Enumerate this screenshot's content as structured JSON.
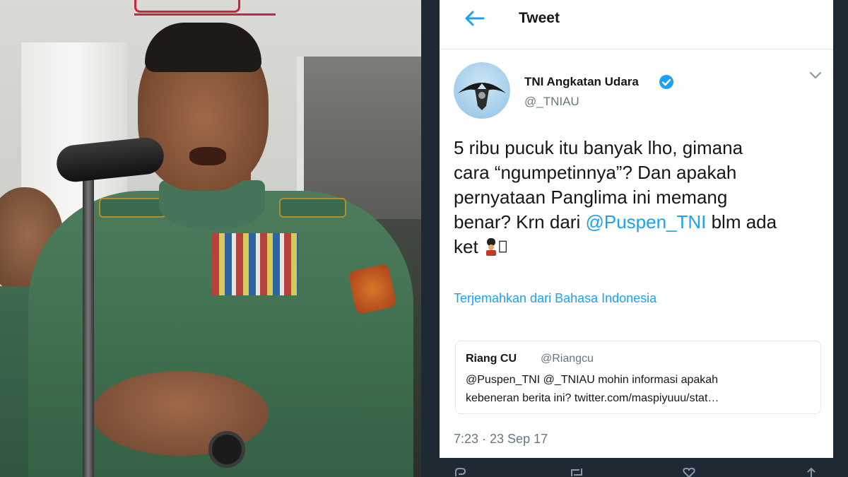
{
  "tweet_screen": {
    "title": "Tweet",
    "icons": {
      "back": "arrow-left-icon",
      "verified": "verified-badge-icon",
      "more": "chevron-down-icon",
      "emoji": "guard-emoji-icon"
    },
    "colors": {
      "accent": "#1da1f2",
      "text": "#14171a",
      "muted": "#657786"
    },
    "author": {
      "name": "TNI Angkatan Udara",
      "handle": "@_TNIAU"
    },
    "tweet": {
      "line1": "5 ribu pucuk itu banyak lho, gimana",
      "line2": "cara “ngumpetinnya”? Dan apakah",
      "line3": "pernyataan Panglima ini memang",
      "line4_before": "benar? Krn dari ",
      "line4_mention": "@Puspen_TNI",
      "line4_after": " blm ada",
      "line5": "ket "
    },
    "translate_link": "Terjemahkan dari Bahasa Indonesia",
    "quoted": {
      "name": "Riang CU",
      "handle": "@Riangcu",
      "text_line1": "@Puspen_TNI @_TNIAU mohin informasi apakah",
      "text_line2": "kebeneran berita ini? twitter.com/maspiyuuu/stat…"
    },
    "timestamp": "7:23 · 23 Sep 17"
  }
}
